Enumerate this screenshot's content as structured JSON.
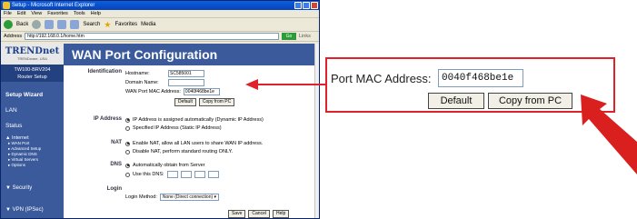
{
  "window": {
    "title": "Setup - Microsoft Internet Explorer",
    "menu": [
      "File",
      "Edit",
      "View",
      "Favorites",
      "Tools",
      "Help"
    ],
    "toolbar": {
      "back": "Back",
      "search": "Search",
      "favorites": "Favorites",
      "media": "Media"
    },
    "address_label": "Address",
    "address": "http://192.168.0.1/home.htm",
    "go": "Go",
    "links": "Links"
  },
  "sidebar": {
    "brand": "TRENDnet",
    "tagline": "TRENDware, USA",
    "model": "TW100-BRV204",
    "model_sub": "Router Setup",
    "items": [
      "Setup Wizard",
      "LAN",
      "Status"
    ],
    "internet": "Internet",
    "internet_sub": [
      "WAN Port",
      "Advanced Setup",
      "Dynamic DNS",
      "Virtual Servers",
      "Options"
    ],
    "security": "Security",
    "vpn": "VPN (IPSec)"
  },
  "page": {
    "title": "WAN Port Configuration",
    "identification": "Identification",
    "hostname_label": "Hostname:",
    "hostname_value": "SC585001",
    "domain_label": "Domain Name:",
    "mac_label": "WAN Port MAC Address:",
    "mac_value": "0040f468be1e",
    "default_btn": "Default",
    "copy_btn": "Copy from PC",
    "ip_section": "IP Address",
    "ip_opt1": "IP Address is assigned automatically (Dynamic IP Address)",
    "ip_opt2": "Specified IP Address (Static IP Address)",
    "nat_section": "NAT",
    "nat_opt1": "Enable NAT, allow all LAN users to share WAN IP address.",
    "nat_opt2": "Disable NAT, perform standard routing ONLY.",
    "dns_section": "DNS",
    "dns_opt1": "Automatically obtain from Server",
    "dns_opt2": "Use this DNS:",
    "login_section": "Login",
    "login_method_label": "Login Method:",
    "login_method_value": "None (Direct connection)",
    "save": "Save",
    "cancel": "Cancel",
    "help": "Help"
  },
  "callout": {
    "mac_label": "Port MAC Address:",
    "mac_value": "0040f468be1e",
    "default_btn": "Default",
    "copy_btn": "Copy from PC"
  },
  "colors": {
    "accent": "#3a5a9c",
    "arrow": "#e0202a"
  }
}
